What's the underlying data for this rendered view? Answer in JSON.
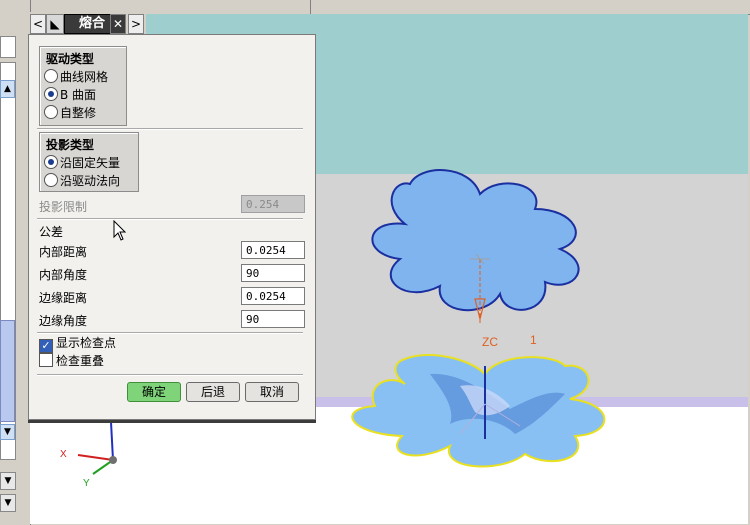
{
  "dialog": {
    "title": "熔合",
    "tab_left": "<",
    "tab_icon": "◣",
    "tab_close": "✕",
    "tab_right": ">",
    "drive_group": {
      "title": "驱动类型",
      "options": [
        {
          "label": "曲线网格",
          "selected": false
        },
        {
          "label": "B 曲面",
          "selected": true
        },
        {
          "label": "自整修",
          "selected": false
        }
      ]
    },
    "projection_group": {
      "title": "投影类型",
      "options": [
        {
          "label": "沿固定矢量",
          "selected": true
        },
        {
          "label": "沿驱动法向",
          "selected": false
        }
      ]
    },
    "projection_limit": {
      "label": "投影限制",
      "value": "0.254",
      "enabled": false
    },
    "tolerance_label": "公差",
    "fields": [
      {
        "label": "内部距离",
        "value": "0.0254"
      },
      {
        "label": "内部角度",
        "value": "90"
      },
      {
        "label": "边缘距离",
        "value": "0.0254"
      },
      {
        "label": "边缘角度",
        "value": "90"
      }
    ],
    "checkboxes": [
      {
        "label": "显示检查点",
        "checked": true
      },
      {
        "label": "检查重叠",
        "checked": false
      }
    ],
    "buttons": {
      "ok": "确定",
      "back": "后退",
      "cancel": "取消"
    }
  },
  "viewport": {
    "zc_label": "ZC",
    "marker_label": "1",
    "triad": {
      "x": "X",
      "y": "Y"
    },
    "colors": {
      "background_top": "#9ecece",
      "background_mid": "#d3d3d3",
      "shape_fill": "#7fb4ef",
      "shape_outline": "#1a2fa0",
      "highlight": "#f0e020",
      "vector": "#e06020"
    }
  }
}
